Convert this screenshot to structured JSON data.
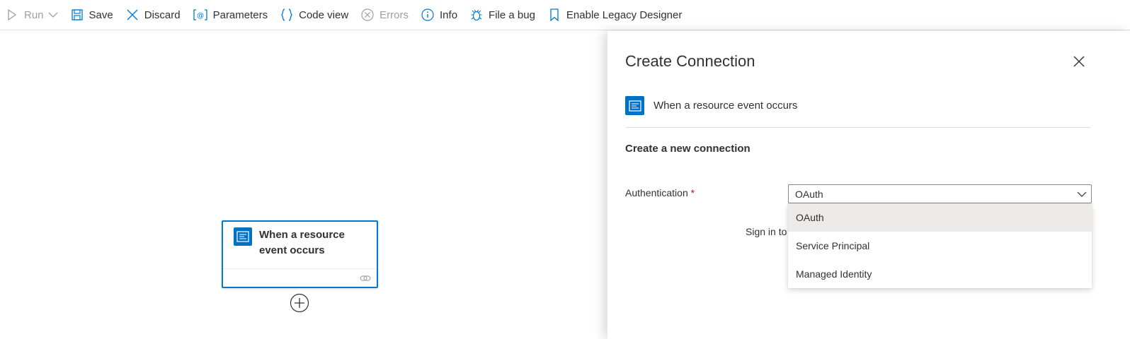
{
  "toolbar": {
    "run": "Run",
    "save": "Save",
    "discard": "Discard",
    "parameters": "Parameters",
    "code_view": "Code view",
    "errors": "Errors",
    "info": "Info",
    "file_bug": "File a bug",
    "legacy": "Enable Legacy Designer"
  },
  "canvas": {
    "trigger_title_line1": "When a resource",
    "trigger_title_line2": "event occurs"
  },
  "panel": {
    "title": "Create Connection",
    "operation": "When a resource event occurs",
    "section": "Create a new connection",
    "auth_label": "Authentication",
    "required_mark": "*",
    "selected_value": "OAuth",
    "sign_in_text": "Sign in to",
    "options": [
      "OAuth",
      "Service Principal",
      "Managed Identity"
    ]
  },
  "colors": {
    "accent": "#0078d4",
    "connector": "#0072c6",
    "required": "#a4262c"
  }
}
